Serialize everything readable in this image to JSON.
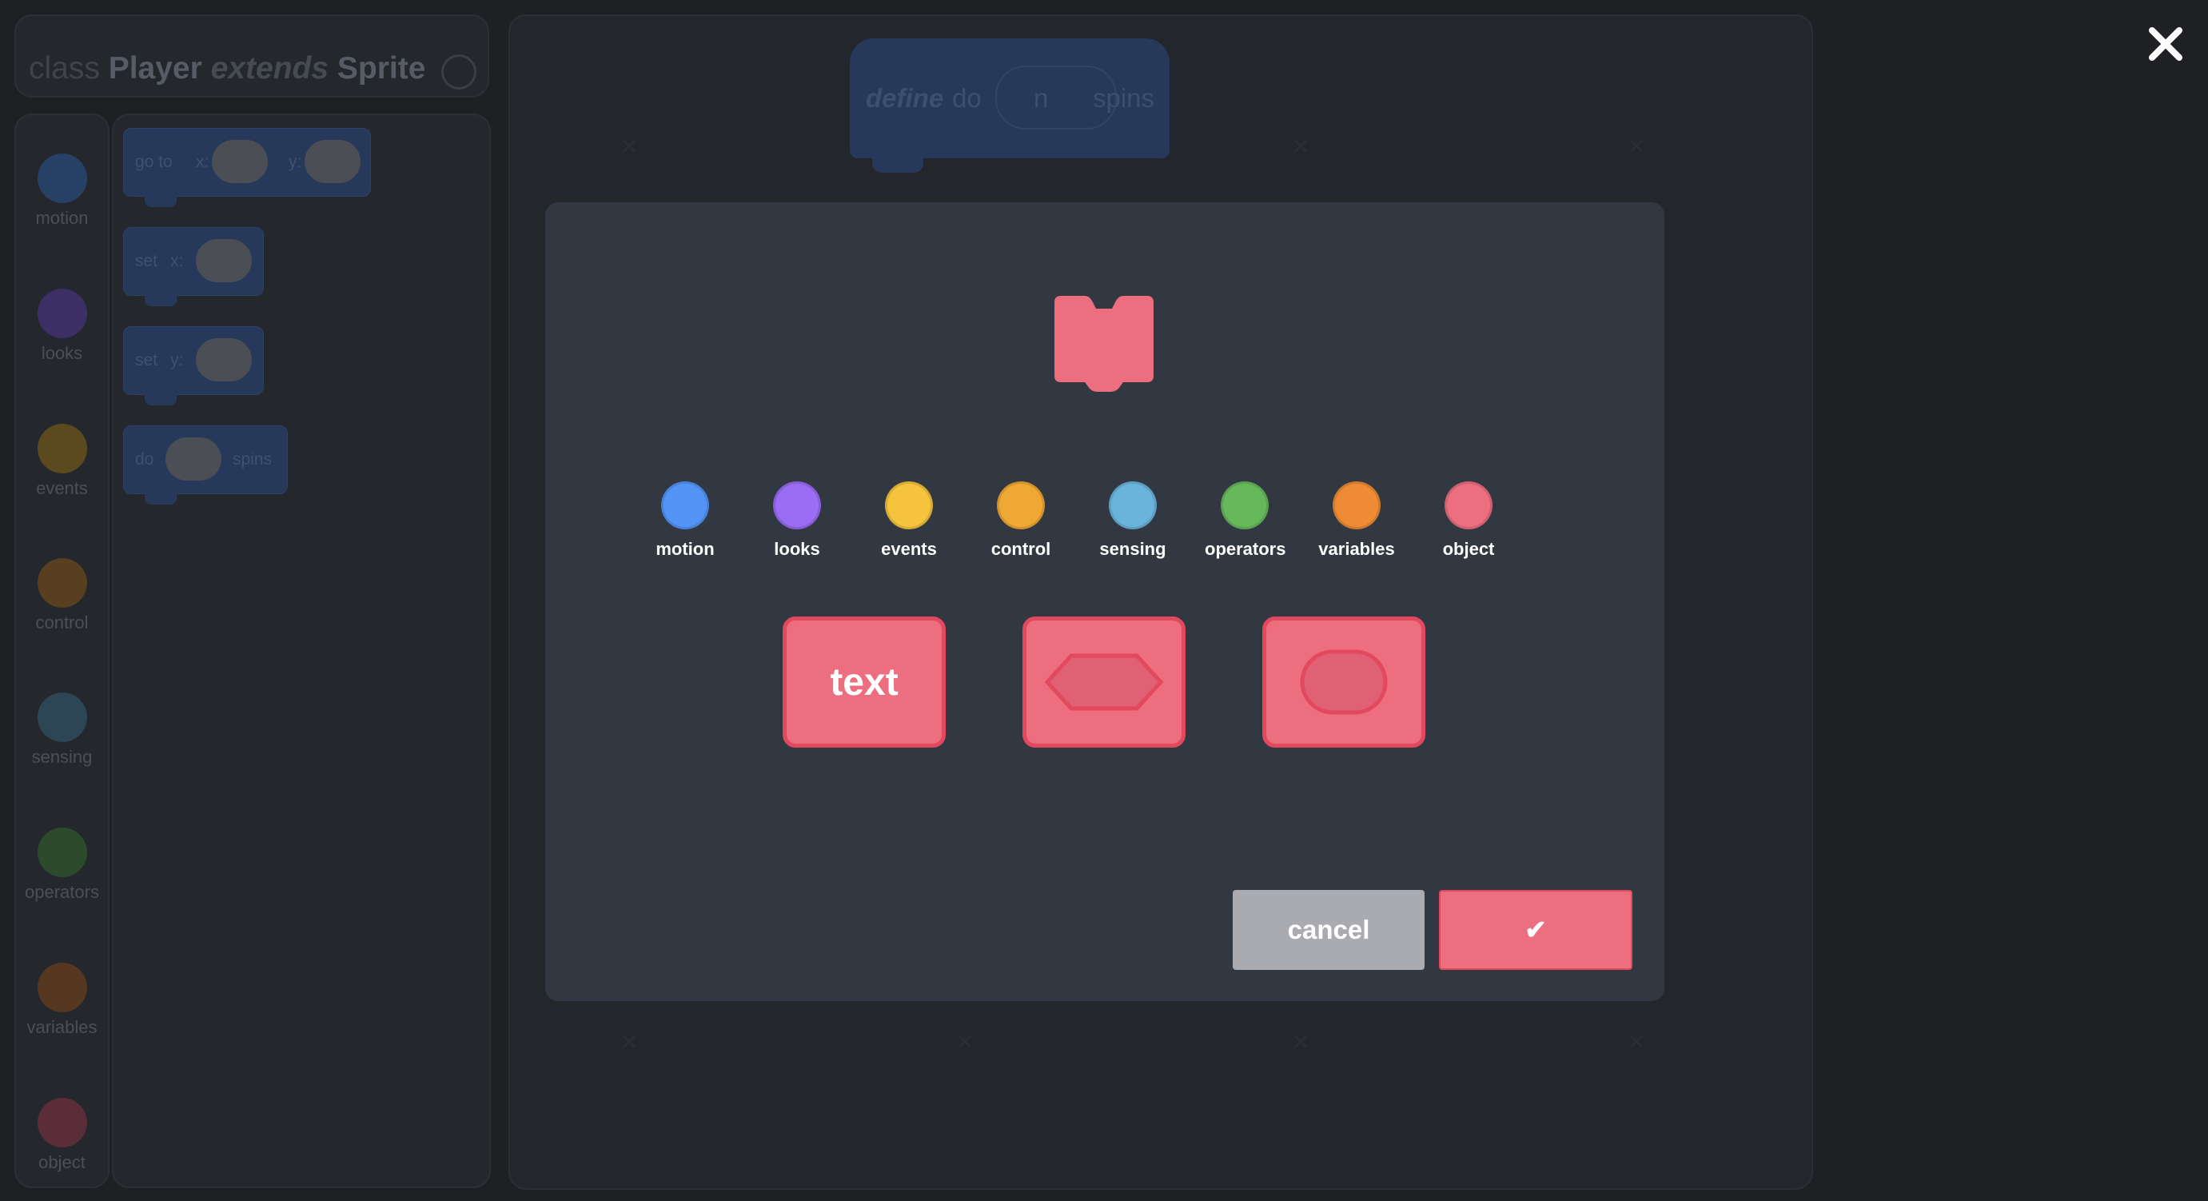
{
  "class_header": {
    "keyword": "class",
    "name": "Player",
    "extends_kw": "extends",
    "parent": "Sprite"
  },
  "categories": [
    {
      "label": "motion",
      "color": "#264066"
    },
    {
      "label": "looks",
      "color": "#3b2f66"
    },
    {
      "label": "events",
      "color": "#5b4a1e"
    },
    {
      "label": "control",
      "color": "#573f1f"
    },
    {
      "label": "sensing",
      "color": "#2c4656"
    },
    {
      "label": "operators",
      "color": "#2c4a2c"
    },
    {
      "label": "variables",
      "color": "#563821"
    },
    {
      "label": "object",
      "color": "#5a2d38"
    }
  ],
  "palette": {
    "goto": {
      "label": "go to",
      "x_label": "x:",
      "y_label": "y:"
    },
    "setx": {
      "label": "set",
      "x_label": "x:"
    },
    "sety": {
      "label": "set",
      "y_label": "y:"
    },
    "do_spins": {
      "label": "do",
      "suffix": "spins"
    }
  },
  "define_block": {
    "define_kw": "define",
    "word": "do",
    "arg": "n",
    "suffix": "spins"
  },
  "dialog": {
    "swatches": [
      {
        "label": "motion",
        "color": "#5295f7"
      },
      {
        "label": "looks",
        "color": "#9b6cf4"
      },
      {
        "label": "events",
        "color": "#f6c33c"
      },
      {
        "label": "control",
        "color": "#f0a834"
      },
      {
        "label": "sensing",
        "color": "#6ab4dc"
      },
      {
        "label": "operators",
        "color": "#66b95b"
      },
      {
        "label": "variables",
        "color": "#ee8b34"
      },
      {
        "label": "object",
        "color": "#ec6e7f"
      }
    ],
    "selected_color": "#ec6e7f",
    "shape_buttons": {
      "text_label": "text"
    },
    "cancel_label": "cancel",
    "confirm_label": "✔"
  }
}
